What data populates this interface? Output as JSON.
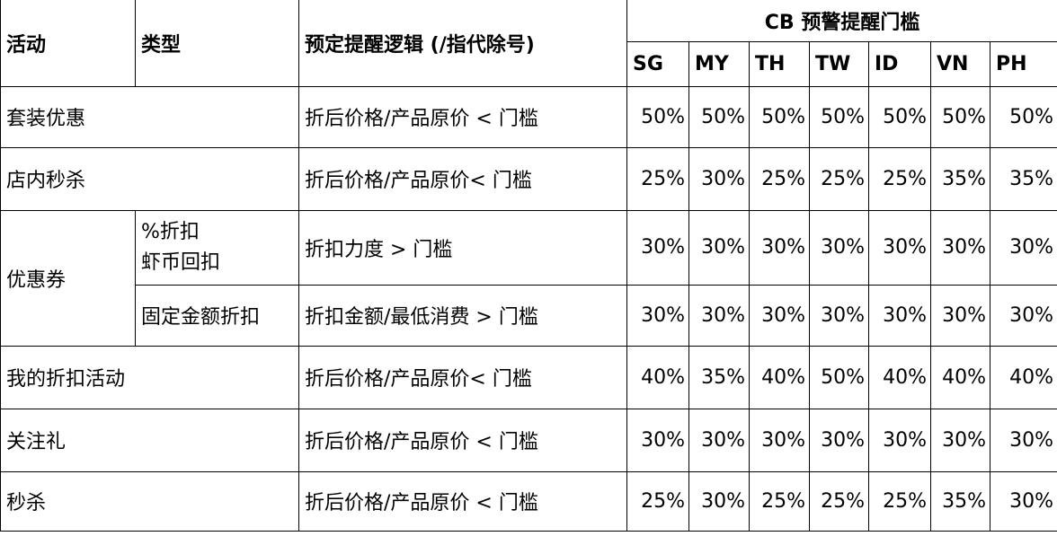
{
  "header": {
    "activity": "活动",
    "type": "类型",
    "logic": "预定提醒逻辑 (/指代除号)",
    "cb_threshold": "CB 预警提醒门槛",
    "countries": [
      "SG",
      "MY",
      "TH",
      "TW",
      "ID",
      "VN",
      "PH"
    ]
  },
  "rows": [
    {
      "activity": "套装优惠",
      "logic": "折后价格/产品原价 < 门槛",
      "values": [
        "50%",
        "50%",
        "50%",
        "50%",
        "50%",
        "50%",
        "50%"
      ]
    },
    {
      "activity": "店内秒杀",
      "logic": "折后价格/产品原价< 门槛",
      "values": [
        "25%",
        "30%",
        "25%",
        "25%",
        "25%",
        "35%",
        "35%"
      ]
    },
    {
      "activity": "优惠券",
      "type_line1": "%折扣",
      "type_line2": "虾币回扣",
      "logic": "折扣力度 > 门槛",
      "values": [
        "30%",
        "30%",
        "30%",
        "30%",
        "30%",
        "30%",
        "30%"
      ]
    },
    {
      "type": "固定金额折扣",
      "logic": "折扣金额/最低消费 > 门槛",
      "values": [
        "30%",
        "30%",
        "30%",
        "30%",
        "30%",
        "30%",
        "30%"
      ]
    },
    {
      "activity": "我的折扣活动",
      "logic": "折后价格/产品原价< 门槛",
      "values": [
        "40%",
        "35%",
        "40%",
        "50%",
        "40%",
        "40%",
        "40%"
      ]
    },
    {
      "activity": "关注礼",
      "logic": "折后价格/产品原价 < 门槛",
      "values": [
        "30%",
        "30%",
        "30%",
        "30%",
        "30%",
        "30%",
        "30%"
      ]
    },
    {
      "activity": "秒杀",
      "logic": "折后价格/产品原价 < 门槛",
      "values": [
        "25%",
        "30%",
        "25%",
        "25%",
        "25%",
        "35%",
        "30%"
      ]
    }
  ]
}
